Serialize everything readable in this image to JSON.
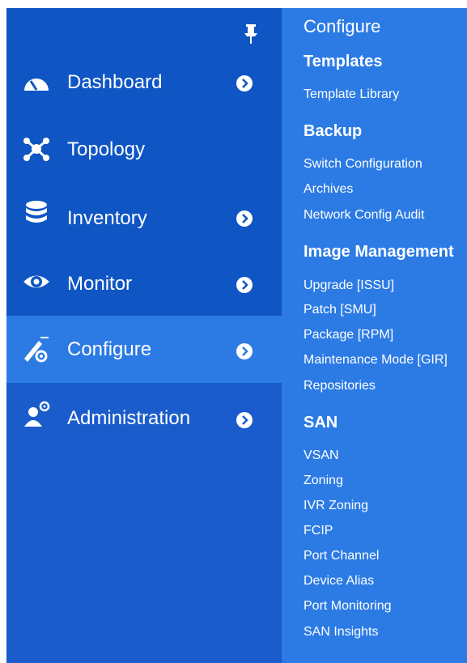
{
  "nav": {
    "items": [
      {
        "label": "Dashboard",
        "icon": "dashboard-gauge-icon",
        "has_submenu": true
      },
      {
        "label": "Topology",
        "icon": "topology-network-icon",
        "has_submenu": false
      },
      {
        "label": "Inventory",
        "icon": "database-icon",
        "has_submenu": true
      },
      {
        "label": "Monitor",
        "icon": "eye-icon",
        "has_submenu": true
      },
      {
        "label": "Configure",
        "icon": "configure-wrench-icon",
        "has_submenu": true,
        "active": true
      },
      {
        "label": "Administration",
        "icon": "admin-user-gear-icon",
        "has_submenu": true
      }
    ],
    "pin_icon": "pin-icon"
  },
  "flyout": {
    "title": "Configure",
    "sections": [
      {
        "heading": "Templates",
        "items": [
          "Template Library"
        ]
      },
      {
        "heading": "Backup",
        "items": [
          "Switch Configuration",
          "Archives",
          "Network Config Audit"
        ]
      },
      {
        "heading": "Image Management",
        "items": [
          "Upgrade [ISSU]",
          "Patch [SMU]",
          "Package [RPM]",
          "Maintenance Mode [GIR]",
          "Repositories"
        ]
      },
      {
        "heading": "SAN",
        "items": [
          "VSAN",
          "Zoning",
          "IVR Zoning",
          "FCIP",
          "Port Channel",
          "Device Alias",
          "Port Monitoring",
          "SAN Insights"
        ]
      }
    ]
  },
  "colors": {
    "sidebar_bg": "#0f55c4",
    "sidebar_lower_bg": "#1a5ccc",
    "active_bg": "#2c7be5",
    "flyout_bg": "#2c7be5",
    "text": "#ffffff"
  }
}
